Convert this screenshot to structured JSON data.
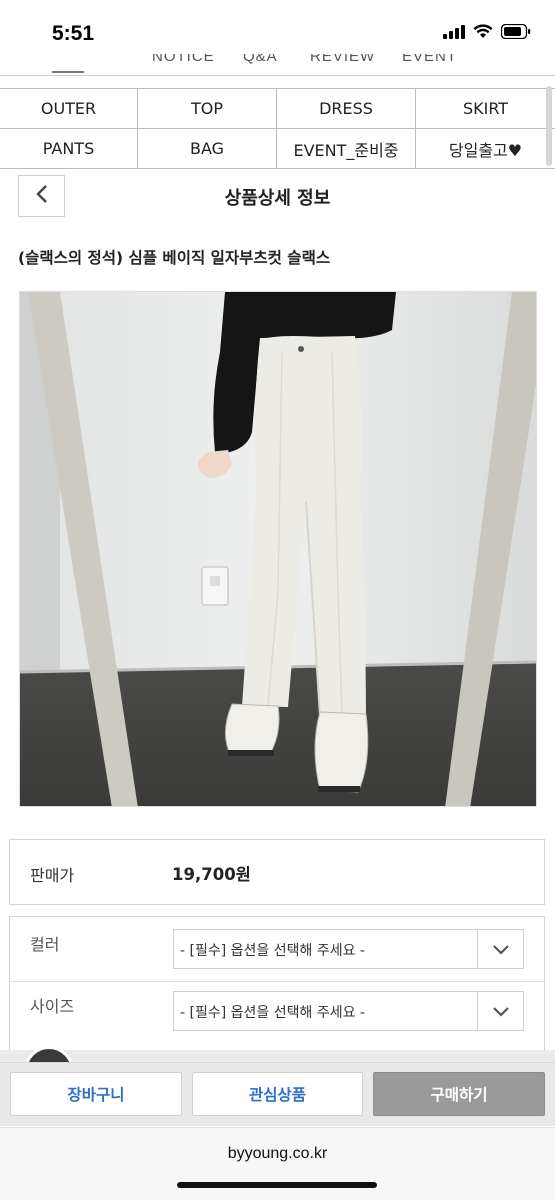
{
  "status_bar": {
    "time": "5:51"
  },
  "top_nav": {
    "peek_items": [
      "NOTICE",
      "Q&A",
      "REVIEW",
      "EVENT"
    ]
  },
  "categories": [
    {
      "label": "OUTER"
    },
    {
      "label": "TOP"
    },
    {
      "label": "DRESS"
    },
    {
      "label": "SKIRT"
    },
    {
      "label": "PANTS"
    },
    {
      "label": "BAG"
    },
    {
      "label": "EVENT_준비중"
    },
    {
      "label": "당일출고♥"
    }
  ],
  "header": {
    "title": "상품상세 정보"
  },
  "product": {
    "name": "(슬랙스의 정석) 심플 베이직 일자부츠컷 슬랙스",
    "price_label": "판매가",
    "price": "19,700원"
  },
  "options": {
    "color": {
      "label": "컬러",
      "selected": "- [필수] 옵션을 선택해 주세요 -"
    },
    "size": {
      "label": "사이즈",
      "selected": "- [필수] 옵션을 선택해 주세요 -"
    }
  },
  "actions": {
    "cart": "장바구니",
    "wishlist": "관심상품",
    "buy": "구매하기"
  },
  "browser": {
    "url": "byyoung.co.kr"
  },
  "colors": {
    "link_blue": "#2b6fc9",
    "buy_gray": "#9a9a9a"
  }
}
